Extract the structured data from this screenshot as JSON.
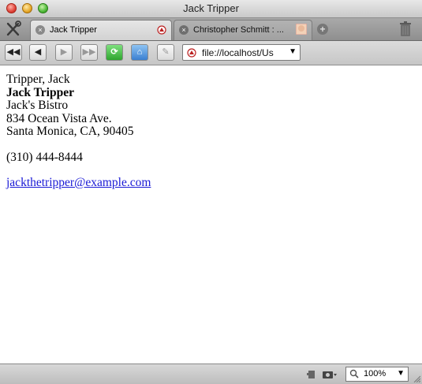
{
  "window": {
    "title": "Jack Tripper"
  },
  "tabs": [
    {
      "label": "Jack Tripper",
      "active": true
    },
    {
      "label": "Christopher Schmitt : ...",
      "active": false
    }
  ],
  "toolbar": {
    "buttons": [
      {
        "name": "back-history-button",
        "icon": "double-left-arrow",
        "glyph": "◀◀"
      },
      {
        "name": "back-button",
        "icon": "left-arrow",
        "glyph": "◀"
      },
      {
        "name": "forward-button",
        "icon": "right-arrow",
        "glyph": "▶"
      },
      {
        "name": "forward-history-button",
        "icon": "double-right-arrow",
        "glyph": "▶▶"
      },
      {
        "name": "reload-button",
        "icon": "reload-icon",
        "glyph": "⟳"
      },
      {
        "name": "home-button",
        "icon": "home-icon",
        "glyph": "⌂"
      },
      {
        "name": "edit-button",
        "icon": "pencil-icon",
        "glyph": "✎"
      }
    ],
    "address": "file://localhost/Us"
  },
  "vcard": {
    "sort_name": "Tripper, Jack",
    "full_name": "Jack Tripper",
    "org": "Jack's Bistro",
    "street": "834 Ocean Vista Ave.",
    "locality": "Santa Monica, CA, 90405",
    "phone": "(310) 444-8444",
    "email": "jackthetripper@example.com"
  },
  "statusbar": {
    "zoom": "100%"
  },
  "colors": {
    "link": "#1a1ad6",
    "close": "#e0443a",
    "minimize": "#e7a92a",
    "maximize": "#4fb93a"
  }
}
